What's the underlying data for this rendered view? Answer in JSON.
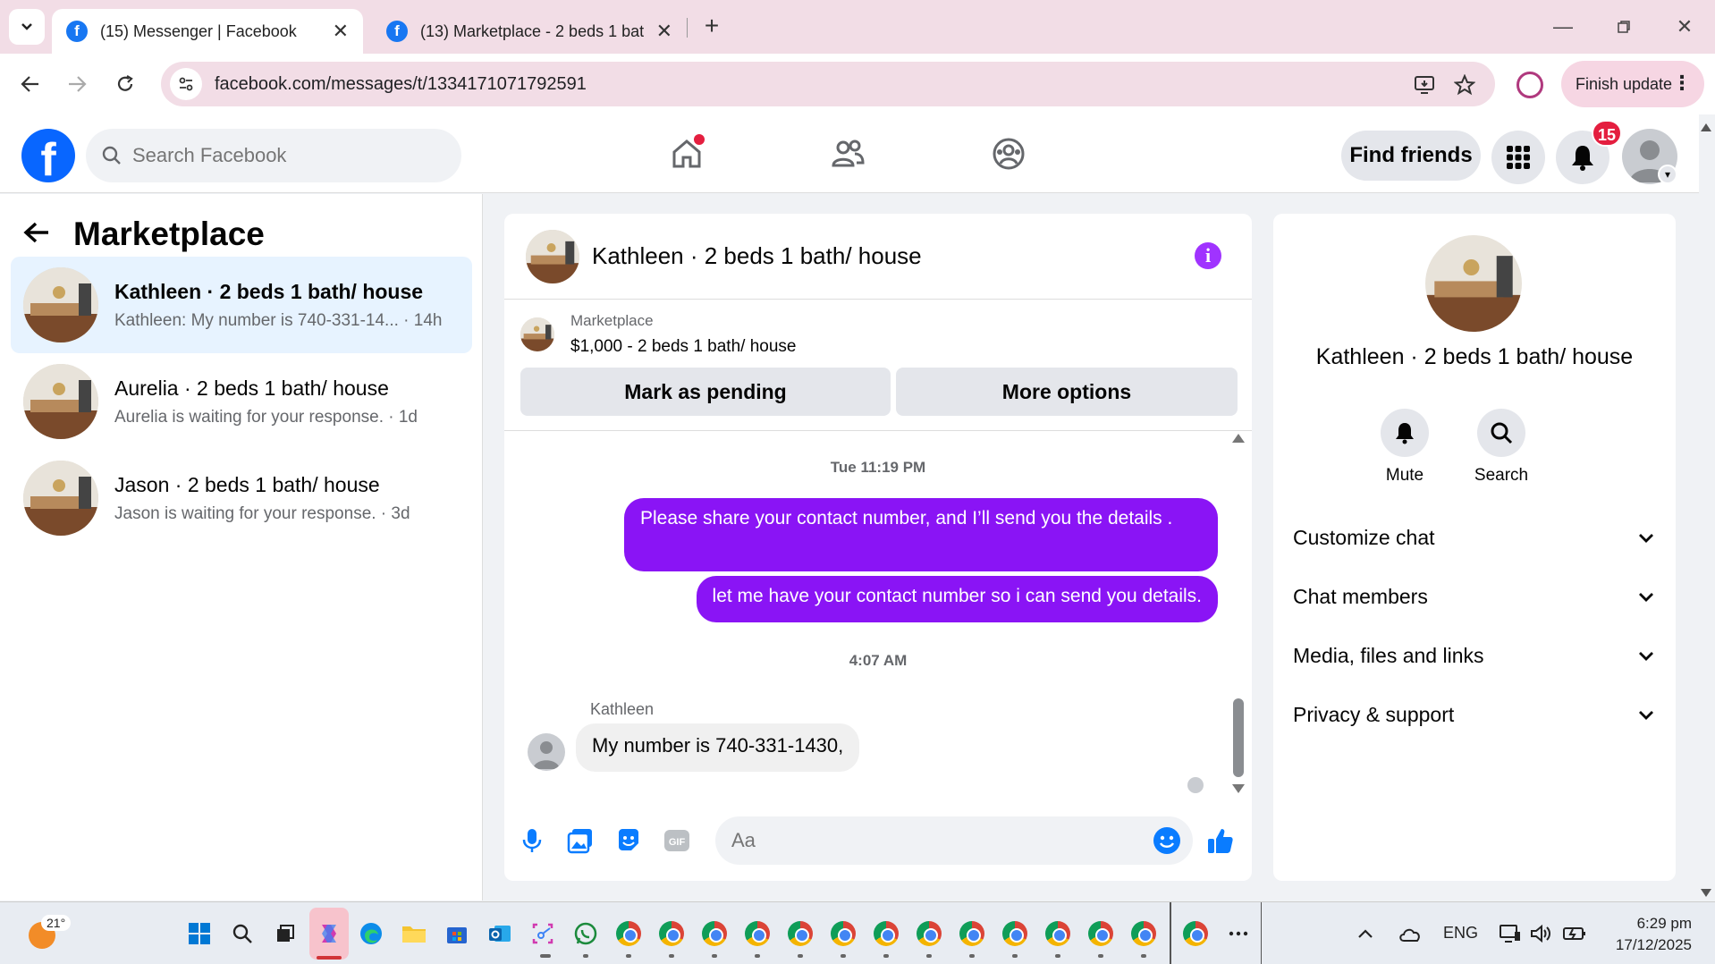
{
  "browser": {
    "tabs": [
      {
        "title": "(15) Messenger | Facebook",
        "active": true
      },
      {
        "title": "(13) Marketplace - 2 beds 1 bat",
        "active": false
      }
    ],
    "url": "facebook.com/messages/t/1334171071792591",
    "finish_update_label": "Finish update"
  },
  "fb_header": {
    "search_placeholder": "Search Facebook",
    "find_friends_label": "Find friends",
    "notification_count": "15"
  },
  "left_panel": {
    "title": "Marketplace",
    "conversations": [
      {
        "name": "Kathleen · 2 beds 1 bath/ house",
        "preview": "Kathleen: My number is 740-331-14...  · 14h",
        "selected": true
      },
      {
        "name": "Aurelia · 2 beds 1 bath/ house",
        "preview": "Aurelia is waiting for your response. · 1d",
        "selected": false
      },
      {
        "name": "Jason · 2 beds 1 bath/ house",
        "preview": "Jason is waiting for your response. · 3d",
        "selected": false
      }
    ]
  },
  "chat": {
    "title": "Kathleen · 2 beds 1 bath/ house",
    "listing_label": "Marketplace",
    "listing_price": "$1,000 - 2 beds 1 bath/ house",
    "mark_pending_label": "Mark as pending",
    "more_options_label": "More options",
    "timestamp_1": "Tue 11:19 PM",
    "outgoing_1": "Please share your contact number, and I’ll send you the details .",
    "outgoing_2": "let me have your contact number so i can send you details.",
    "timestamp_2": "4:07 AM",
    "incoming_sender": "Kathleen",
    "incoming_1": "My  number is 740-331-1430,",
    "composer_placeholder": "Aa"
  },
  "right_panel": {
    "name": "Kathleen · 2 beds 1 bath/ house",
    "mute_label": "Mute",
    "search_label": "Search",
    "sections": [
      "Customize chat",
      "Chat members",
      "Media, files and links",
      "Privacy & support"
    ]
  },
  "taskbar": {
    "temperature": "21°",
    "language": "ENG",
    "time": "6:29 pm",
    "date": "17/12/2025"
  },
  "colors": {
    "fb_blue": "#0866ff",
    "outgoing_bubble": "#8a14f5",
    "selected_row": "#e7f3ff",
    "notification_red": "#e41e3f",
    "tab_strip": "#f2dde6"
  }
}
